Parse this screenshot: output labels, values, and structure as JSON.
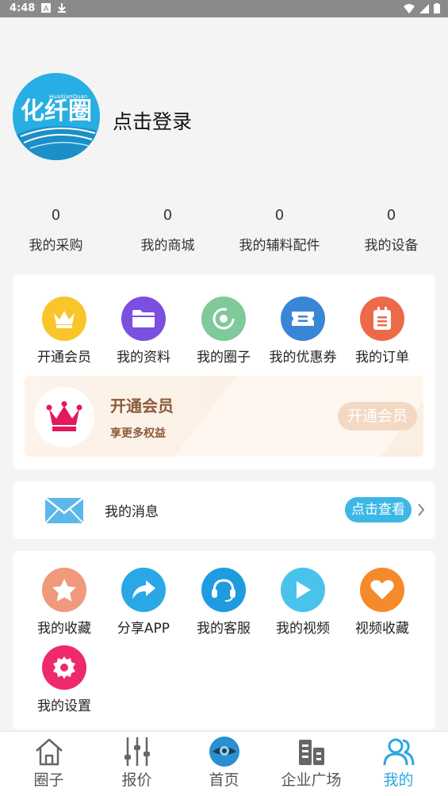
{
  "status_bar": {
    "time": "4:48"
  },
  "profile": {
    "login_text": "点击登录",
    "logo_text": "化纤圈",
    "logo_sub": "HuaXianQuan"
  },
  "stats": [
    {
      "count": "0",
      "label": "我的采购"
    },
    {
      "count": "0",
      "label": "我的商城"
    },
    {
      "count": "0",
      "label": "我的辅料配件"
    },
    {
      "count": "0",
      "label": "我的设备"
    }
  ],
  "quick_menu": [
    {
      "label": "开通会员",
      "icon": "crown-icon",
      "color": "#f9c52a"
    },
    {
      "label": "我的资料",
      "icon": "folder-icon",
      "color": "#7b4fe0"
    },
    {
      "label": "我的圈子",
      "icon": "circle-icon",
      "color": "#7fc99a"
    },
    {
      "label": "我的优惠券",
      "icon": "coupon-icon",
      "color": "#3a86d6"
    },
    {
      "label": "我的订单",
      "icon": "order-icon",
      "color": "#ec6a4a"
    }
  ],
  "vip_banner": {
    "title": "开通会员",
    "subtitle": "享更多权益",
    "button": "开通会员"
  },
  "messages": {
    "label": "我的消息",
    "button": "点击查看"
  },
  "services": [
    {
      "label": "我的收藏",
      "icon": "star-icon",
      "color": "#f0997b"
    },
    {
      "label": "分享APP",
      "icon": "share-icon",
      "color": "#2aa7e6"
    },
    {
      "label": "我的客服",
      "icon": "headset-icon",
      "color": "#1f9be0"
    },
    {
      "label": "我的视频",
      "icon": "play-icon",
      "color": "#4ac3ec"
    },
    {
      "label": "视频收藏",
      "icon": "heart-icon",
      "color": "#f58a2a"
    },
    {
      "label": "我的设置",
      "icon": "settings-icon",
      "color": "#ee2a6b"
    }
  ],
  "tabbar": [
    {
      "label": "圈子",
      "icon": "home-icon"
    },
    {
      "label": "报价",
      "icon": "sliders-icon"
    },
    {
      "label": "首页",
      "icon": "eye-icon"
    },
    {
      "label": "企业广场",
      "icon": "buildings-icon"
    },
    {
      "label": "我的",
      "icon": "users-icon",
      "active": true
    }
  ]
}
